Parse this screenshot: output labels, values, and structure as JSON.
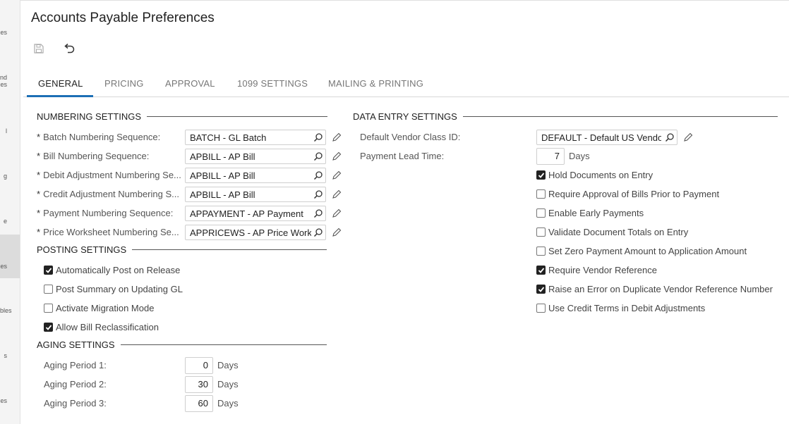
{
  "nav": [
    "es",
    "nd",
    "es",
    "l",
    "g",
    "e",
    "es",
    "bles",
    "s",
    "es"
  ],
  "title": "Accounts Payable Preferences",
  "tabs": [
    "GENERAL",
    "PRICING",
    "APPROVAL",
    "1099 SETTINGS",
    "MAILING & PRINTING"
  ],
  "numbering": {
    "header": "NUMBERING SETTINGS",
    "rows": [
      {
        "label": "Batch Numbering Sequence:",
        "value": "BATCH - GL Batch"
      },
      {
        "label": "Bill Numbering Sequence:",
        "value": "APBILL - AP Bill"
      },
      {
        "label": "Debit Adjustment Numbering Se...",
        "value": "APBILL - AP Bill"
      },
      {
        "label": "Credit Adjustment Numbering S...",
        "value": "APBILL - AP Bill"
      },
      {
        "label": "Payment Numbering Sequence:",
        "value": "APPAYMENT - AP Payment"
      },
      {
        "label": "Price Worksheet Numbering Se...",
        "value": "APPRICEWS - AP Price Work"
      }
    ]
  },
  "posting": {
    "header": "POSTING SETTINGS",
    "checks": [
      {
        "label": "Automatically Post on Release",
        "checked": true
      },
      {
        "label": "Post Summary on Updating GL",
        "checked": false
      },
      {
        "label": "Activate Migration Mode",
        "checked": false
      },
      {
        "label": "Allow Bill Reclassification",
        "checked": true
      }
    ]
  },
  "aging": {
    "header": "AGING SETTINGS",
    "rows": [
      {
        "label": "Aging Period 1:",
        "value": "0",
        "unit": "Days"
      },
      {
        "label": "Aging Period 2:",
        "value": "30",
        "unit": "Days"
      },
      {
        "label": "Aging Period 3:",
        "value": "60",
        "unit": "Days"
      }
    ]
  },
  "data_entry": {
    "header": "DATA ENTRY SETTINGS",
    "vendor_class_label": "Default Vendor Class ID:",
    "vendor_class_value": "DEFAULT - Default US Vendor",
    "lead_time_label": "Payment Lead Time:",
    "lead_time_value": "7",
    "lead_time_unit": "Days",
    "checks": [
      {
        "label": "Hold Documents on Entry",
        "checked": true
      },
      {
        "label": "Require Approval of Bills Prior to Payment",
        "checked": false
      },
      {
        "label": "Enable Early Payments",
        "checked": false
      },
      {
        "label": "Validate Document Totals on Entry",
        "checked": false
      },
      {
        "label": "Set Zero Payment Amount to Application Amount",
        "checked": false
      },
      {
        "label": "Require Vendor Reference",
        "checked": true
      },
      {
        "label": "Raise an Error on Duplicate Vendor Reference Number",
        "checked": true
      },
      {
        "label": "Use Credit Terms in Debit Adjustments",
        "checked": false
      }
    ]
  }
}
